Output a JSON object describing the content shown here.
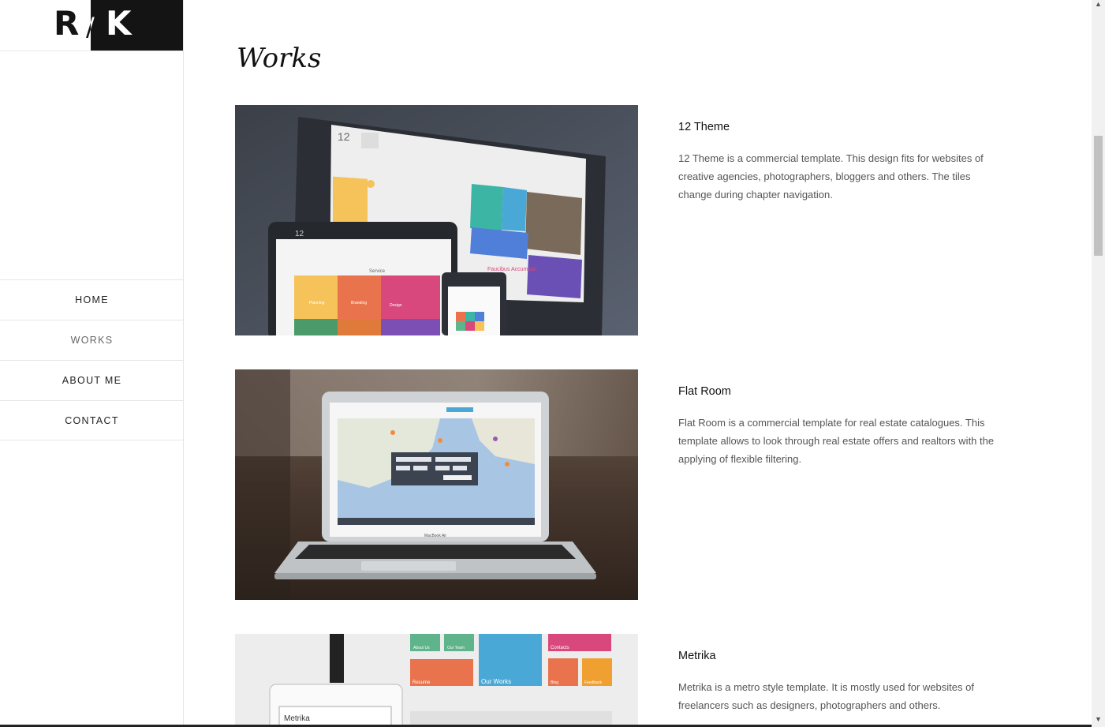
{
  "logo": {
    "left": "R",
    "slash": "/",
    "right": "K"
  },
  "nav": [
    {
      "label": "HOME"
    },
    {
      "label": "WORKS"
    },
    {
      "label": "ABOUT ME"
    },
    {
      "label": "CONTACT"
    }
  ],
  "page": {
    "title": "Works"
  },
  "works": [
    {
      "title": "12 Theme",
      "description": "12 Theme is a commercial template. This design fits for websites of creative agencies, photographers, bloggers and others. The tiles change during chapter navigation.",
      "mock": {
        "badge": "12",
        "tiles": [
          "Planning",
          "Branding",
          "Design"
        ],
        "service": "Service",
        "caption": "Faucibus Accumsan",
        "badge_small": "12"
      }
    },
    {
      "title": "Flat Room",
      "description": "Flat Room is a commercial template for real estate catalogues. This template allows to look through real estate offers and realtors with the applying of flexible filtering.",
      "mock": {
        "brand": "MacBook Air"
      }
    },
    {
      "title": "Metrika",
      "description": "Metrika is a metro style template. It is mostly used for websites of freelancers such as designers, photographers and others.",
      "mock": {
        "tiles": [
          "About Us",
          "Our Team",
          "Contacts",
          "Resume",
          "Our Works",
          "Blog",
          "Feedback"
        ],
        "device_label": "Metrika"
      }
    }
  ],
  "colors": {
    "accent_dark": "#141414",
    "tile_yellow": "#f5c35a",
    "tile_orange": "#e9734d",
    "tile_pink": "#d9487c",
    "tile_teal": "#3cb5a5",
    "tile_blue": "#4f7fd9",
    "tile_green": "#5fb48b",
    "tile_sky": "#4aa8d6"
  }
}
